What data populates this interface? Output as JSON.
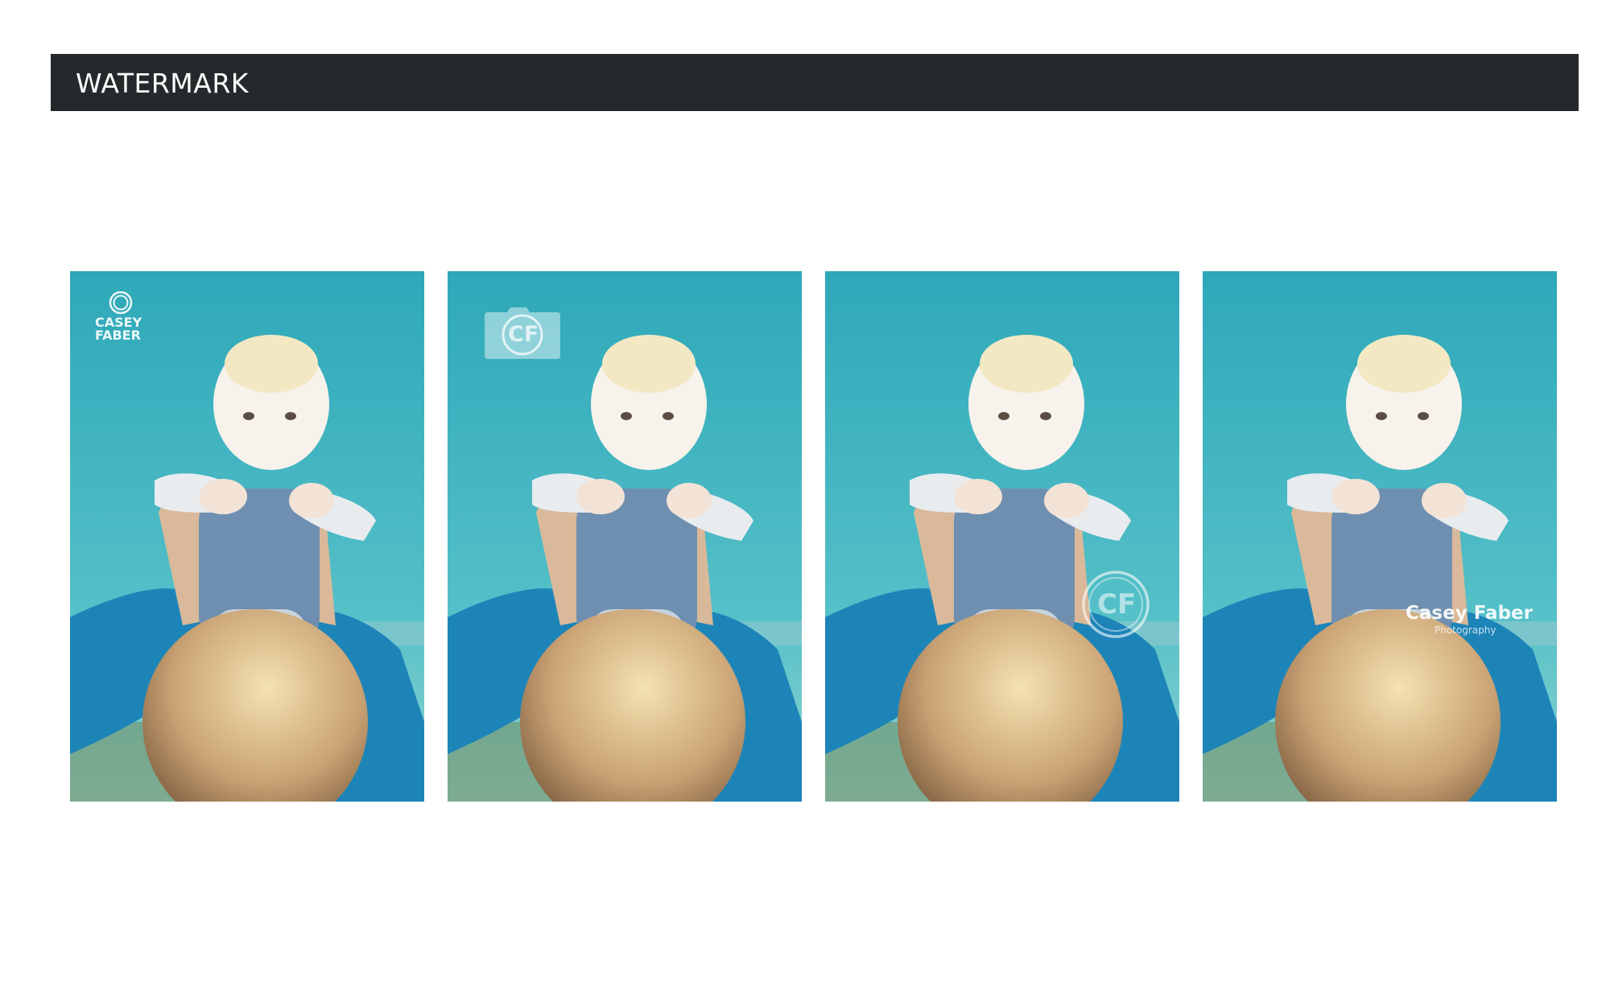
{
  "header": {
    "title": "WATERMARK"
  },
  "panels": [
    {
      "variant": "stacked-logo",
      "watermark": {
        "line1": "CASEY",
        "line2": "FABER"
      }
    },
    {
      "variant": "camera-monogram",
      "watermark": {
        "monogram": "CF"
      }
    },
    {
      "variant": "circle-monogram",
      "watermark": {
        "monogram": "CF"
      }
    },
    {
      "variant": "script-wordmark",
      "watermark": {
        "name": "Casey Faber",
        "tagline": "Photography"
      }
    }
  ],
  "colors": {
    "header_bg": "#242a2b",
    "sky_top": "#2ea8b9",
    "sky_bottom": "#5ec6cc",
    "sweater": "#1d84b8"
  }
}
